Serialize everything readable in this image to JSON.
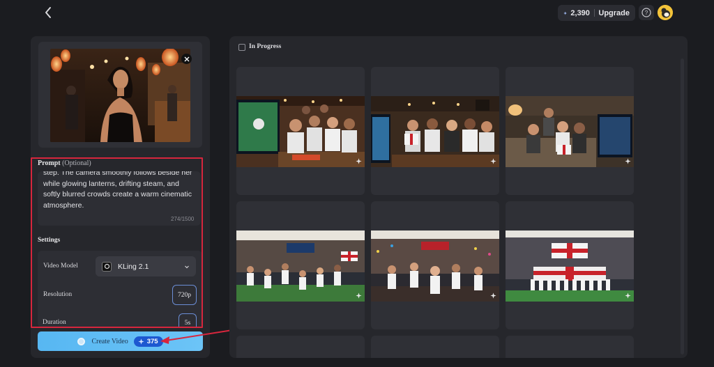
{
  "header": {
    "credits_amount": "2,390",
    "upgrade_label": "Upgrade",
    "help_symbol": "?"
  },
  "left": {
    "prompt_label": "Prompt",
    "prompt_optional": "(Optional)",
    "prompt_text": "step. The camera smoothly follows beside her while glowing lanterns, drifting steam, and softly blurred crowds create a warm cinematic atmosphere.",
    "char_count": "274/1500",
    "settings_label": "Settings",
    "video_model_label": "Video Model",
    "video_model_value": "KLing 2.1",
    "resolution_label": "Resolution",
    "resolution_value": "720p",
    "duration_label": "Duration",
    "duration_value": "5s",
    "create_label": "Create Video",
    "create_cost": "375"
  },
  "right": {
    "in_progress_label": "In Progress",
    "thumbnails": [
      "living-room-tv-shock",
      "living-room-tv-watch",
      "living-room-tv-tense",
      "stadium-players-celebrate",
      "stadium-goal-celebration",
      "stadium-team-anthem"
    ]
  },
  "colors": {
    "background": "#1b1c20",
    "panel": "#26272c",
    "card": "#2f3036",
    "accent_blue": "#57b7f2",
    "cost_pill": "#1d58d1",
    "highlight_red": "#d7263d"
  }
}
